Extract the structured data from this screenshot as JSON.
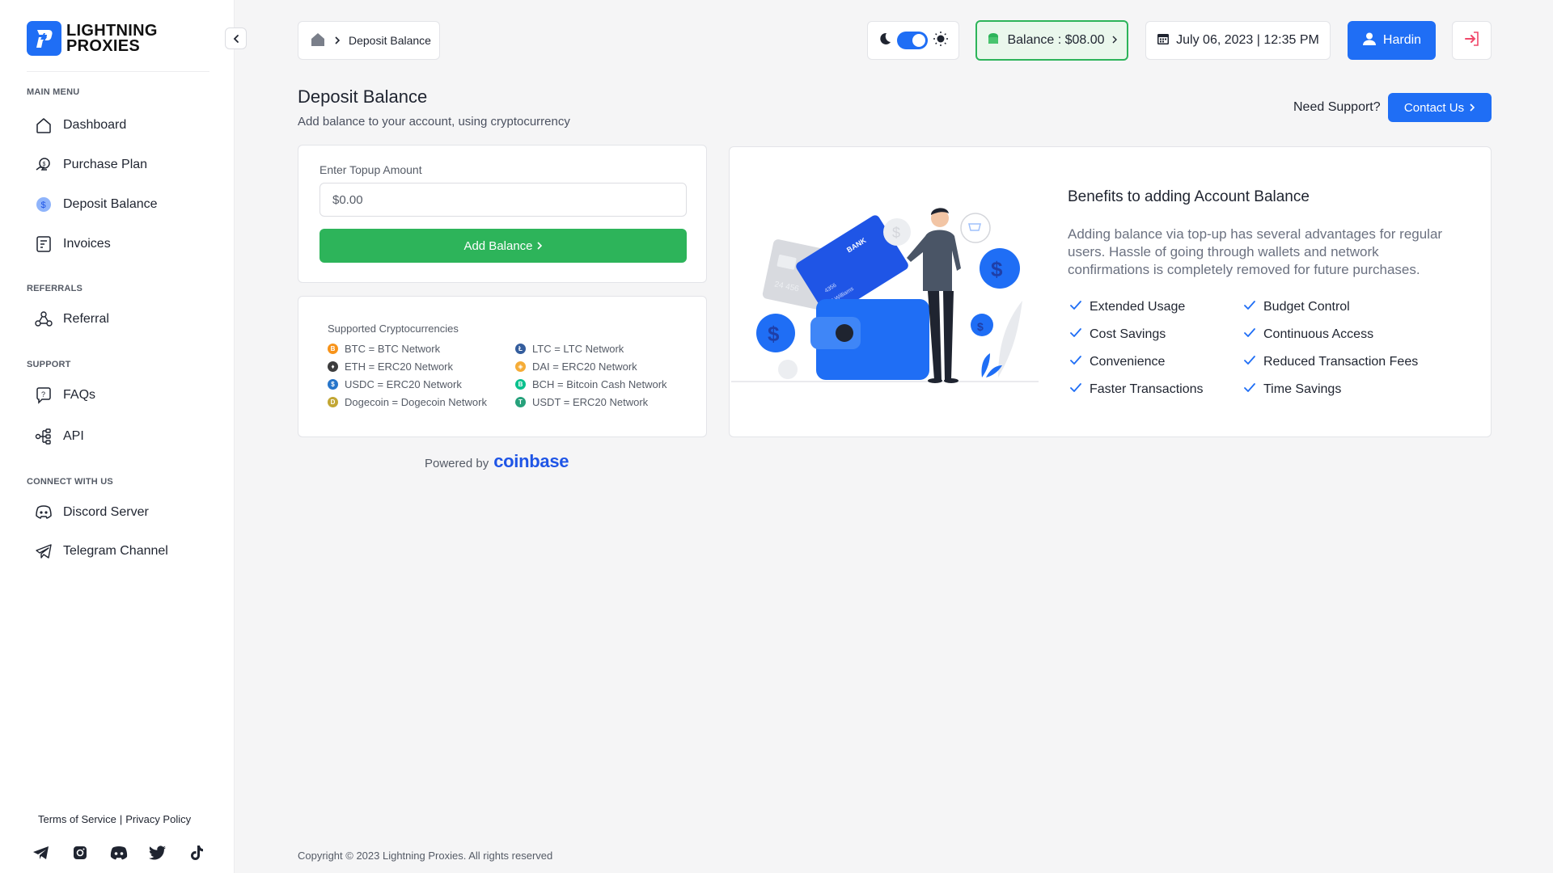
{
  "brand": {
    "line1": "LIGHTNING",
    "line2": "PROXIES"
  },
  "sidebar": {
    "sections": {
      "main": "MAIN MENU",
      "referrals": "REFERRALS",
      "support": "SUPPORT",
      "connect": "CONNECT WITH US"
    },
    "items": {
      "dashboard": "Dashboard",
      "purchase_plan": "Purchase Plan",
      "deposit_balance": "Deposit Balance",
      "invoices": "Invoices",
      "referral": "Referral",
      "faqs": "FAQs",
      "api": "API",
      "discord": "Discord Server",
      "telegram": "Telegram Channel"
    },
    "footer": {
      "terms": "Terms of Service",
      "separator": "|",
      "privacy": "Privacy Policy"
    }
  },
  "topbar": {
    "breadcrumb": "Deposit Balance",
    "balance": "Balance : $08.00",
    "datetime": "July 06, 2023 | 12:35 PM",
    "user": "Hardin"
  },
  "header": {
    "title": "Deposit Balance",
    "subtitle": "Add balance to your account, using cryptocurrency",
    "support_label": "Need Support?",
    "contact_button": "Contact Us"
  },
  "topup": {
    "label": "Enter Topup Amount",
    "placeholder": "$0.00",
    "button": "Add Balance"
  },
  "crypto": {
    "heading": "Supported Cryptocurrencies",
    "items": [
      {
        "text": "BTC = BTC Network",
        "color": "#f7931a",
        "glyph": "B"
      },
      {
        "text": "LTC = LTC Network",
        "color": "#345d9d",
        "glyph": "Ł"
      },
      {
        "text": "ETH = ERC20 Network",
        "color": "#3c3c3d",
        "glyph": "♦"
      },
      {
        "text": "DAI = ERC20 Network",
        "color": "#f5ac37",
        "glyph": "◈"
      },
      {
        "text": "USDC = ERC20 Network",
        "color": "#2775ca",
        "glyph": "$"
      },
      {
        "text": "BCH = Bitcoin Cash Network",
        "color": "#0ac18e",
        "glyph": "B"
      },
      {
        "text": "Dogecoin = Dogecoin Network",
        "color": "#c2a633",
        "glyph": "D"
      },
      {
        "text": "USDT = ERC20 Network",
        "color": "#26a17b",
        "glyph": "T"
      }
    ]
  },
  "powered": {
    "label": "Powered by",
    "brand": "coinbase"
  },
  "benefits": {
    "title": "Benefits to adding Account Balance",
    "description": "Adding balance via top-up has several advantages for regular users. Hassle of going through wallets and network confirmations is completely removed for future purchases.",
    "items": [
      "Extended Usage",
      "Budget Control",
      "Cost Savings",
      "Continuous Access",
      "Convenience",
      "Reduced Transaction Fees",
      "Faster Transactions",
      "Time Savings"
    ],
    "illustration_text": {
      "bank": "BANK",
      "holder": "J.Williams",
      "card_number": "4356",
      "back_number": "24 456"
    }
  },
  "copyright": "Copyright © 2023 Lightning Proxies. All rights reserved",
  "colors": {
    "primary": "#1f6ef5",
    "success": "#2db45a",
    "balance_bg": "#eaf7ec"
  }
}
